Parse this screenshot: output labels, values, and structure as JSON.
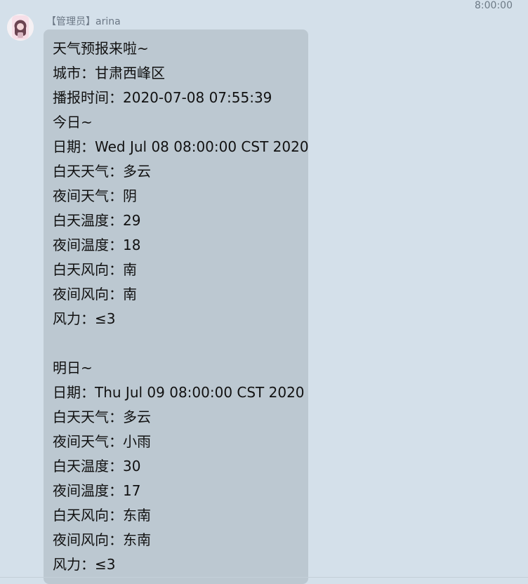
{
  "timestamp": "8:00:00",
  "sender": "【管理员】arina",
  "message": {
    "lines": [
      "天气预报来啦~",
      "城市：甘肃西峰区",
      "播报时间：2020-07-08 07:55:39",
      "今日~",
      "日期：Wed Jul 08 08:00:00 CST 2020",
      "白天天气：多云",
      "夜间天气：阴",
      "白天温度：29",
      "夜间温度：18",
      "白天风向：南",
      "夜间风向：南",
      "风力：≤3",
      "明日~",
      "日期：Thu Jul 09 08:00:00 CST 2020",
      "白天天气：多云",
      "夜间天气：小雨",
      "白天温度：30",
      "夜间温度：17",
      "白天风向：东南",
      "夜间风向：东南",
      "风力：≤3"
    ]
  }
}
